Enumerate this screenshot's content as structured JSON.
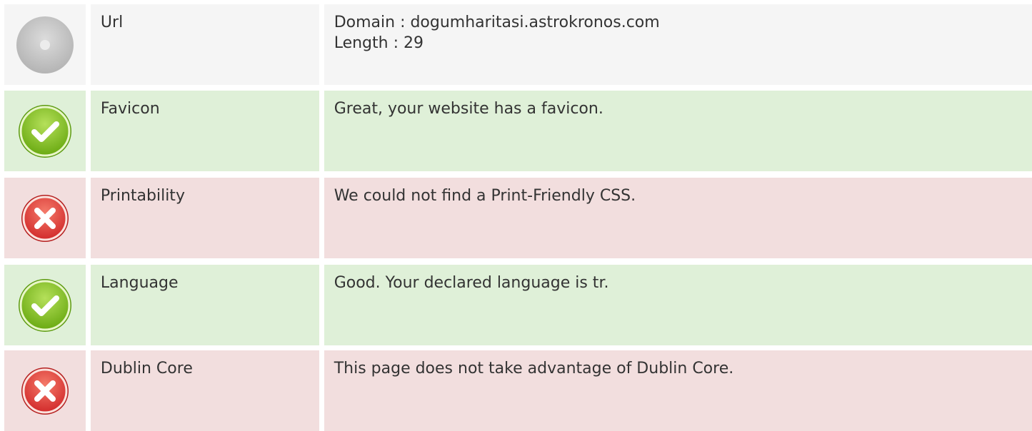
{
  "rows": [
    {
      "status": "neutral",
      "icon": "info-circle-icon",
      "name": "Url",
      "desc_lines": [
        "Domain : dogumharitasi.astrokronos.com",
        "Length : 29"
      ]
    },
    {
      "status": "pass",
      "icon": "check-circle-icon",
      "name": "Favicon",
      "desc_lines": [
        "Great, your website has a favicon."
      ]
    },
    {
      "status": "fail",
      "icon": "cross-circle-icon",
      "name": "Printability",
      "desc_lines": [
        "We could not find a Print-Friendly CSS."
      ]
    },
    {
      "status": "pass",
      "icon": "check-circle-icon",
      "name": "Language",
      "desc_lines": [
        "Good. Your declared language is tr."
      ]
    },
    {
      "status": "fail",
      "icon": "cross-circle-icon",
      "name": "Dublin Core",
      "desc_lines": [
        "This page does not take advantage of Dublin Core."
      ]
    }
  ],
  "colors": {
    "neutral_bg": "#f5f5f5",
    "pass_bg": "#dff0d8",
    "fail_bg": "#f2dede",
    "pass_icon": "#7cbf1e",
    "fail_icon": "#e03a3a",
    "neutral_icon": "#c8c8c8"
  }
}
